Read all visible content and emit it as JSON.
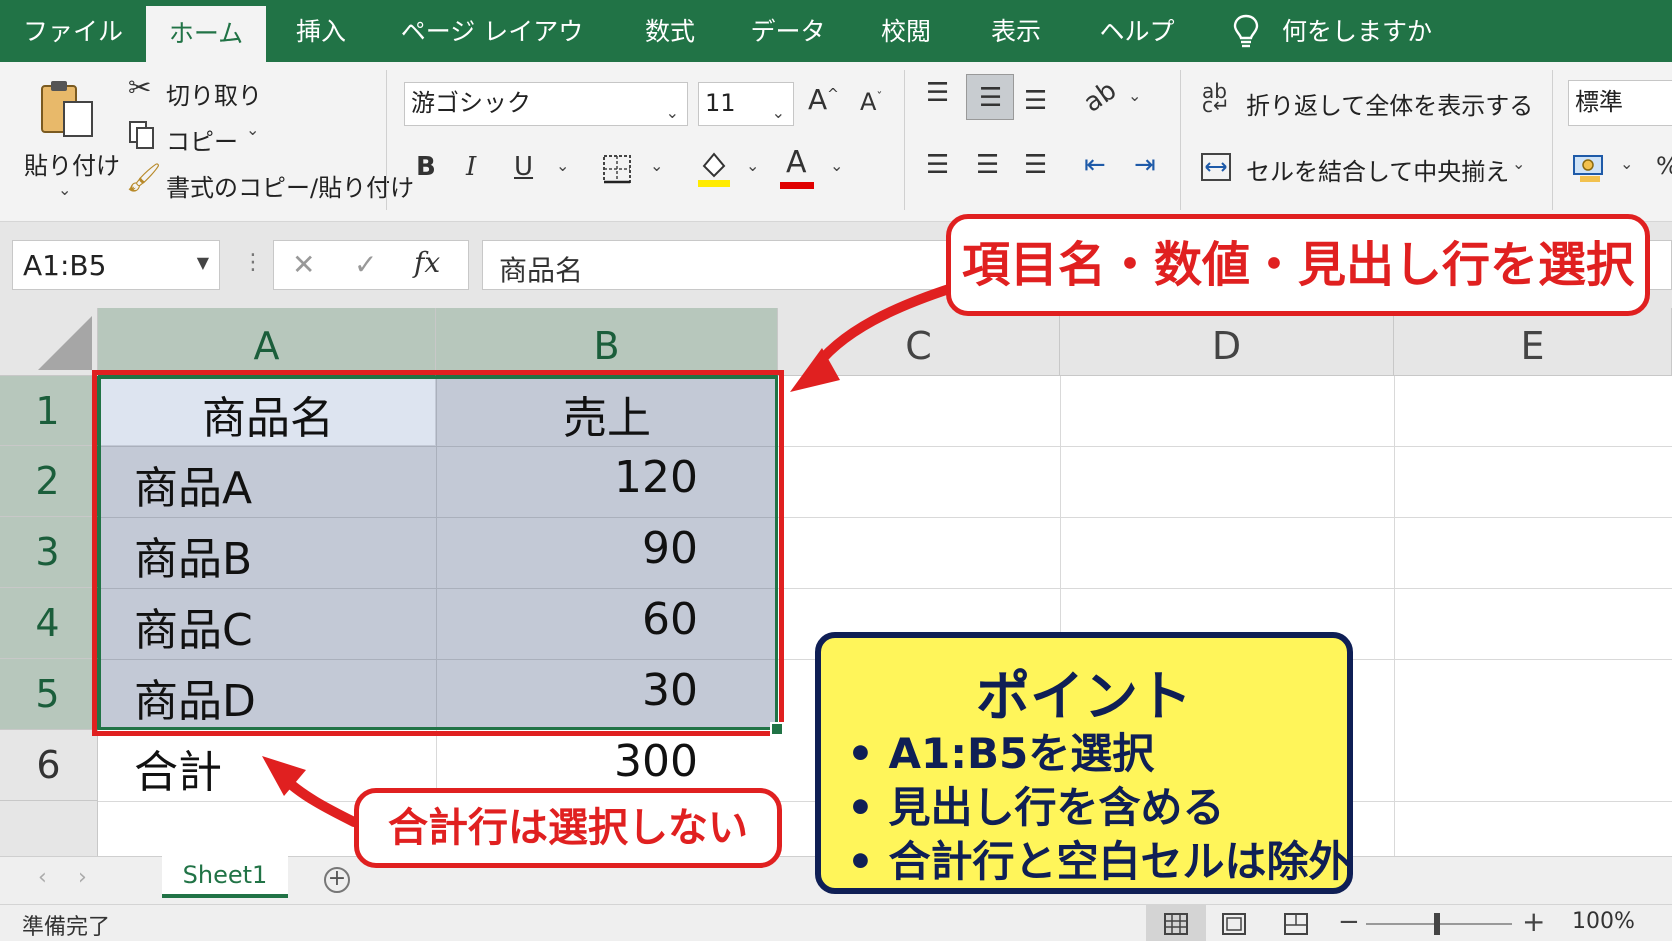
{
  "tabs": [
    "ファイル",
    "ホーム",
    "挿入",
    "ページ レイアウト",
    "数式",
    "データ",
    "校閲",
    "表示",
    "ヘルプ"
  ],
  "tell_me": "何をしますか",
  "clipboard": {
    "paste": "貼り付け",
    "cut": "切り取り",
    "copy": "コピー",
    "format_painter": "書式のコピー/貼り付け"
  },
  "font": {
    "name": "游ゴシック",
    "size": "11",
    "bold": "B",
    "italic": "I",
    "underline": "U",
    "grow": "A",
    "shrink": "A",
    "font_color_glyph": "A"
  },
  "alignment": {
    "wrap_text": "折り返して全体を表示する",
    "merge_center": "セルを結合して中央揃え"
  },
  "number": {
    "format": "標準",
    "percent": "%"
  },
  "formula_bar": {
    "name_box": "A1:B5",
    "fx": "fx",
    "content": "商品名"
  },
  "columns": [
    "A",
    "B",
    "C",
    "D",
    "E"
  ],
  "rows": [
    "1",
    "2",
    "3",
    "4",
    "5",
    "6"
  ],
  "cells": {
    "a1": "商品名",
    "b1": "売上",
    "a2": "商品A",
    "b2": "120",
    "a3": "商品B",
    "b3": "90",
    "a4": "商品C",
    "b4": "60",
    "a5": "商品D",
    "b5": "30",
    "a6": "合計",
    "b6": "300"
  },
  "annotations": {
    "top": "項目名・数値・見出し行を選択",
    "bottom": "合計行は選択しない",
    "point_title": "ポイント",
    "point_items": [
      "• A1:B5を選択",
      "• 見出し行を含める",
      "• 合計行と空白セルは除外"
    ]
  },
  "sheet_tab": "Sheet1",
  "status": {
    "ready": "準備完了",
    "zoom": "100%"
  },
  "colors": {
    "excel_green": "#217346",
    "selection": "#c3c9d6",
    "callout_red": "#e02020",
    "point_yellow": "#fff55a",
    "point_navy": "#0f1f55"
  }
}
